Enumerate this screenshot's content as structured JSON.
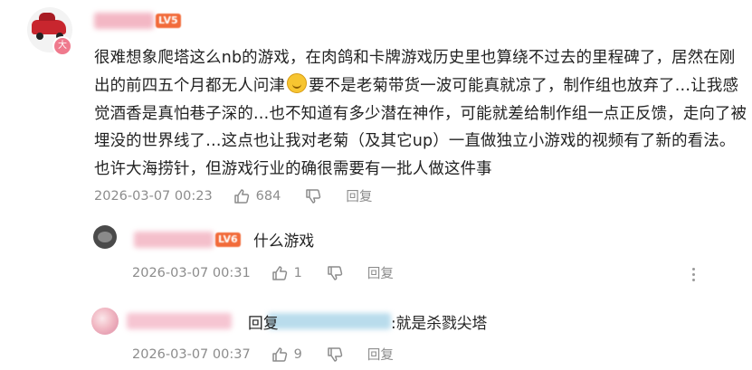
{
  "comment": {
    "badge_text": "大",
    "level": "LV5",
    "text_before_emoji": "很难想象爬塔这么nb的游戏，在肉鸽和卡牌游戏历史里也算绕不过去的里程碑了，居然在刚出的前四五个月都无人问津",
    "emoji_icon": "laughing-crying-emoji",
    "text_after_emoji": "要不是老菊带货一波可能真就凉了，制作组也放弃了…让我感觉酒香是真怕巷子深的…也不知道有多少潜在神作，可能就差给制作组一点正反馈，走向了被埋没的世界线了…这点也让我对老菊（及其它up）一直做独立小游戏的视频有了新的看法。也许大海捞针，但游戏行业的确很需要有一批人做这件事",
    "date": "2026-03-07 00:23",
    "likes": "684",
    "reply_label": "回复"
  },
  "replies": [
    {
      "level": "LV6",
      "text": "什么游戏",
      "date": "2026-03-07 00:31",
      "likes": "1",
      "reply_label": "回复"
    },
    {
      "prefix": "回复",
      "text": ":就是杀戮尖塔",
      "date": "2026-03-07 00:37",
      "likes": "9",
      "reply_label": "回复"
    }
  ],
  "colors": {
    "meta_gray": "#8c8c8c",
    "level_orange": "#f26b3a",
    "badge_pink": "#ef7a8d"
  }
}
